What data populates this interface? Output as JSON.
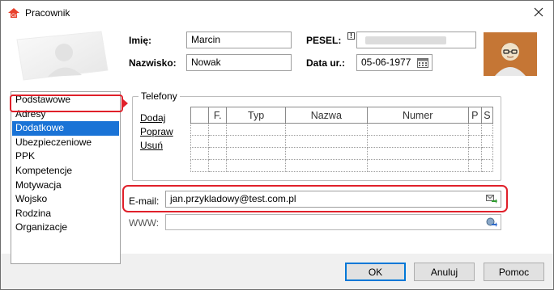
{
  "window": {
    "title": "Pracownik",
    "app_icon": "comarch-app-icon",
    "close_icon": "close-icon"
  },
  "header": {
    "first_name_label": "Imię:",
    "first_name_value": "Marcin",
    "last_name_label": "Nazwisko:",
    "last_name_value": "Nowak",
    "pesel_label": "PESEL:",
    "pesel_warning": "!",
    "birth_date_label": "Data ur.:",
    "birth_date_value": "05-06-1977"
  },
  "sidebar": {
    "items": [
      {
        "label": "Podstawowe",
        "selected": false
      },
      {
        "label": "Adresy",
        "selected": false
      },
      {
        "label": "Dodatkowe",
        "selected": true
      },
      {
        "label": "Ubezpieczeniowe",
        "selected": false
      },
      {
        "label": "PPK",
        "selected": false
      },
      {
        "label": "Kompetencje",
        "selected": false
      },
      {
        "label": "Motywacja",
        "selected": false
      },
      {
        "label": "Wojsko",
        "selected": false
      },
      {
        "label": "Rodzina",
        "selected": false
      },
      {
        "label": "Organizacje",
        "selected": false
      }
    ]
  },
  "phones": {
    "title": "Telefony",
    "actions": {
      "add": "Dodaj",
      "edit": "Popraw",
      "delete": "Usuń"
    },
    "columns": [
      "F.",
      "Typ",
      "Nazwa",
      "Numer",
      "P",
      "S"
    ]
  },
  "contact": {
    "email_label": "E-mail:",
    "email_value": "jan.przykladowy@test.com.pl",
    "www_label": "WWW:",
    "www_value": ""
  },
  "footer": {
    "ok": "OK",
    "cancel": "Anuluj",
    "help": "Pomoc"
  },
  "colors": {
    "accent": "#1a73d6",
    "highlight": "#e0202a"
  }
}
